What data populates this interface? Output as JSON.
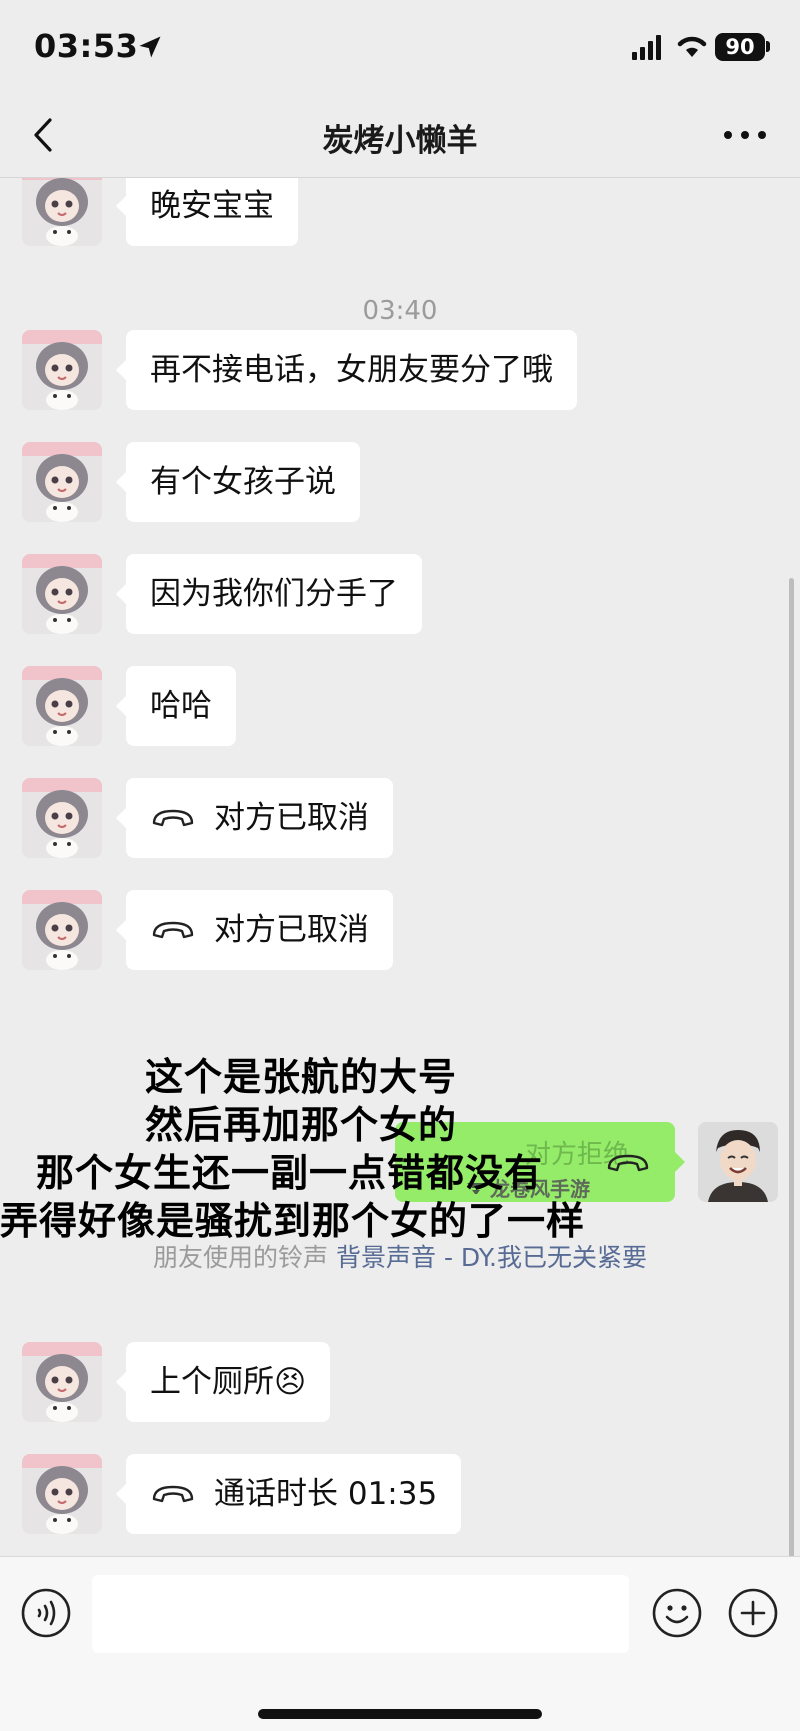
{
  "status_bar": {
    "time": "03:53",
    "battery": "90"
  },
  "nav": {
    "title": "炭烤小懒羊"
  },
  "messages": [
    {
      "text": "晚安宝宝"
    },
    {
      "text": "再不接电话，女朋友要分了哦"
    },
    {
      "text": "有个女孩子说"
    },
    {
      "text": "因为我你们分手了"
    },
    {
      "text": "哈哈"
    },
    {
      "text": "对方已取消",
      "icon": "phone-hangup-icon"
    },
    {
      "text": "对方已取消",
      "icon": "phone-hangup-icon"
    },
    {
      "text": "上个厕所😣"
    },
    {
      "text": "通话时长 01:35",
      "icon": "phone-hangup-icon"
    }
  ],
  "timestamp": "03:40",
  "outgoing_call": {
    "text": "对方拒绝",
    "icon": "phone-hangup-icon"
  },
  "ringtone": {
    "prefix": "朋友使用的铃声",
    "song": "背景声音 - DY.我已无关紧要"
  },
  "overlay_caption": [
    "这个是张航的大号",
    "然后再加那个女的",
    "那个女生还一副一点错都没有",
    "弄得好像是骚扰到那个女的了一样"
  ],
  "watermark": "龙卷风手游",
  "input": {
    "placeholder": ""
  },
  "colors": {
    "background": "#ededed",
    "bubble_in": "#ffffff",
    "bubble_out": "#95ec69",
    "link": "#576b95"
  }
}
